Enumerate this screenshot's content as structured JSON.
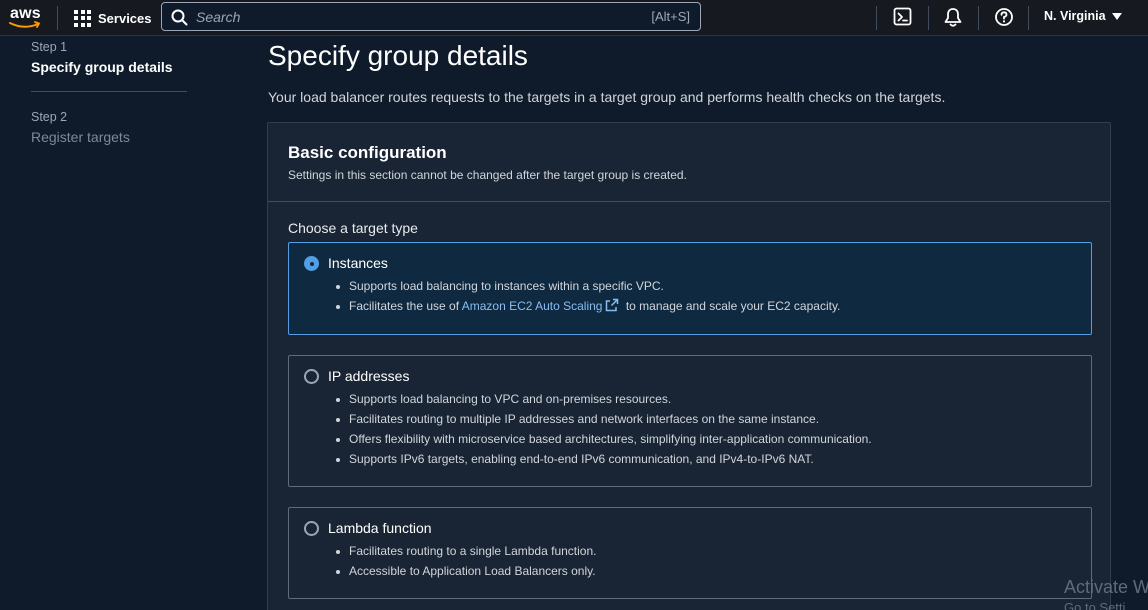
{
  "nav": {
    "logo": "aws",
    "services_label": "Services",
    "search_placeholder": "Search",
    "search_shortcut": "[Alt+S]",
    "region": "N. Virginia",
    "icons": [
      "cloudshell-icon",
      "bell-icon",
      "help-icon"
    ]
  },
  "steps": [
    {
      "label": "Step 1",
      "title": "Specify group details",
      "active": true
    },
    {
      "label": "Step 2",
      "title": "Register targets",
      "active": false
    }
  ],
  "page": {
    "title": "Specify group details",
    "description": "Your load balancer routes requests to the targets in a target group and performs health checks on the targets."
  },
  "basic_config": {
    "title": "Basic configuration",
    "description": "Settings in this section cannot be changed after the target group is created.",
    "choose_label": "Choose a target type",
    "options": [
      {
        "label": "Instances",
        "selected": true,
        "bullets": [
          "Supports load balancing to instances within a specific VPC.",
          "Facilitates the use of"
        ],
        "link_text": "Amazon EC2 Auto Scaling",
        "link_suffix": "to manage and scale your EC2 capacity."
      },
      {
        "label": "IP addresses",
        "selected": false,
        "bullets": [
          "Supports load balancing to VPC and on-premises resources.",
          "Facilitates routing to multiple IP addresses and network interfaces on the same instance.",
          "Offers flexibility with microservice based architectures, simplifying inter-application communication.",
          "Supports IPv6 targets, enabling end-to-end IPv6 communication, and IPv4-to-IPv6 NAT."
        ]
      },
      {
        "label": "Lambda function",
        "selected": false,
        "bullets": [
          "Facilitates routing to a single Lambda function.",
          "Accessible to Application Load Balancers only."
        ]
      }
    ]
  },
  "watermark": {
    "line1": "Activate W",
    "line2": "Go to Setti"
  },
  "colors": {
    "accent": "#539fe5",
    "link": "#89bdf0",
    "nav_bg": "#16191f",
    "page_bg": "#0f1b2a"
  }
}
